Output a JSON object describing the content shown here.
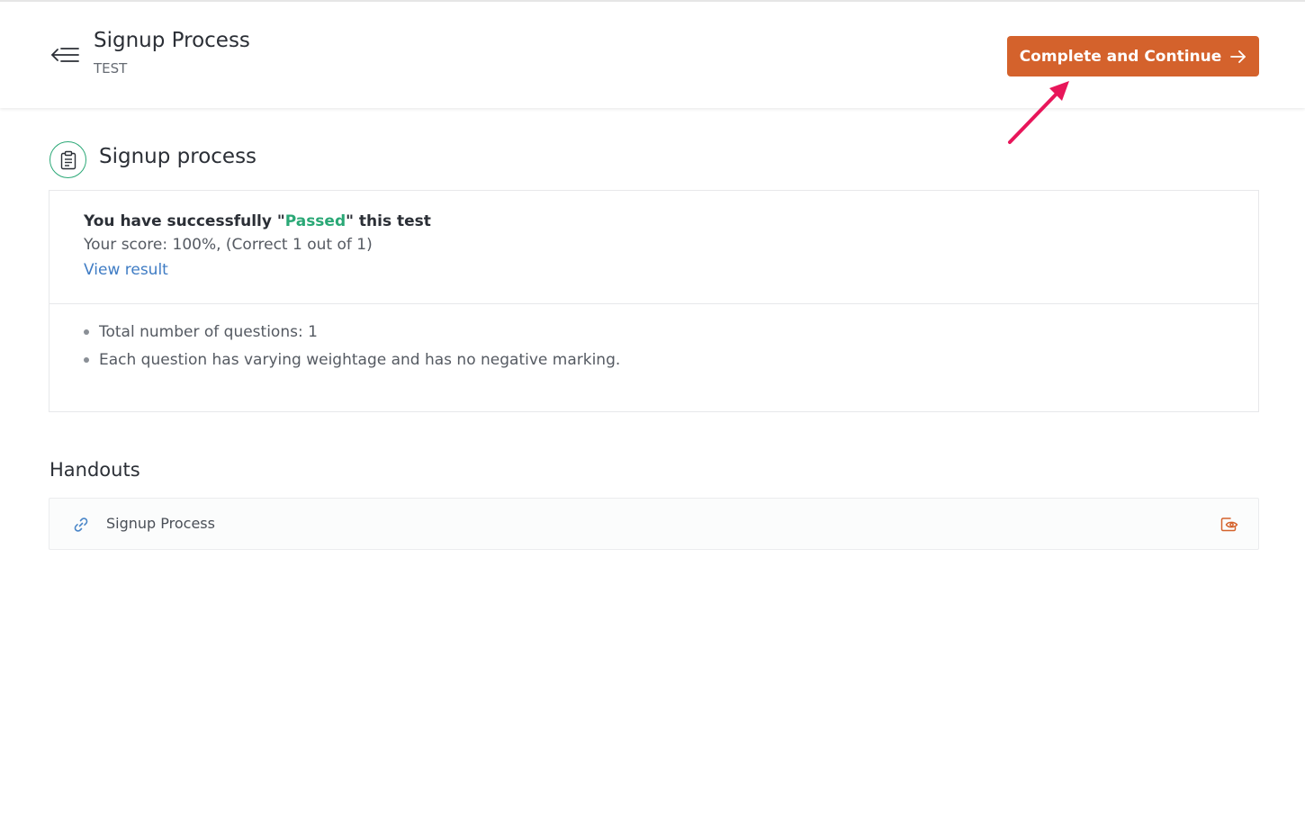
{
  "header": {
    "title": "Signup Process",
    "subtitle": "TEST",
    "complete_button_label": "Complete and Continue"
  },
  "test": {
    "title": "Signup process",
    "result": {
      "prefix": "You have successfully \"",
      "status": "Passed",
      "suffix": "\" this test",
      "score_text": "Your score: 100%, (Correct 1 out of 1)",
      "view_result_label": "View result"
    },
    "info": [
      "Total number of questions: 1",
      "Each question has varying weightage and has no negative marking."
    ]
  },
  "handouts": {
    "title": "Handouts",
    "items": [
      {
        "label": "Signup Process"
      }
    ]
  },
  "colors": {
    "accent": "#d4622c",
    "success": "#2aa876",
    "link": "#3f7cc4",
    "annotation": "#e8165a"
  },
  "icons": {
    "menu": "collapse-menu-icon",
    "complete_arrow": "arrow-right-icon",
    "test": "clipboard-icon",
    "handout_link": "link-icon",
    "handout_view": "eye-view-icon"
  }
}
